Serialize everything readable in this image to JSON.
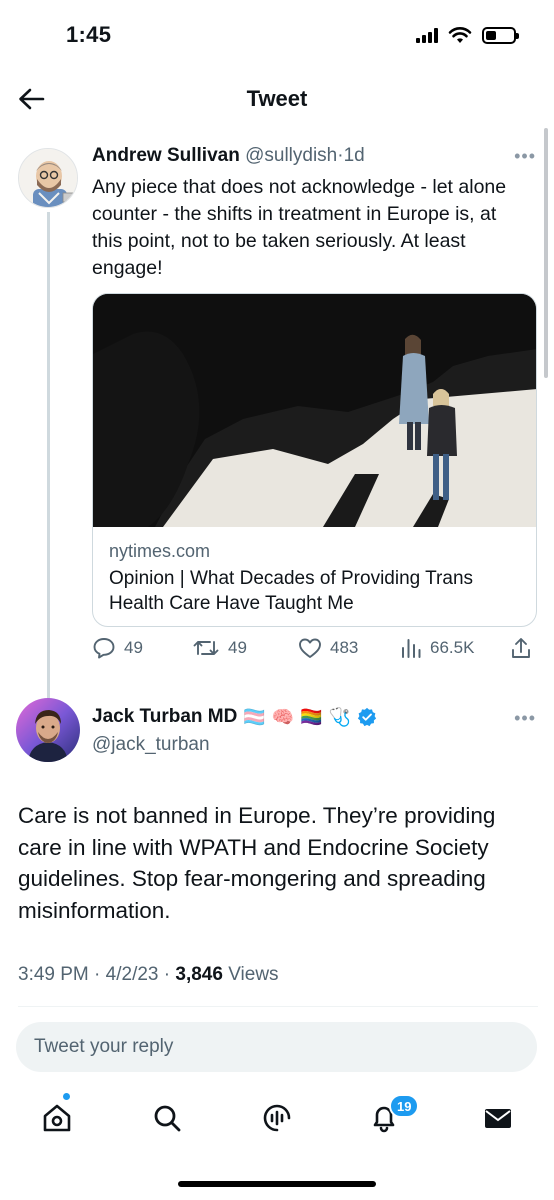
{
  "status_bar": {
    "time": "1:45",
    "icons": [
      "signal-icon",
      "wifi-icon",
      "battery-icon"
    ],
    "battery_level": 0.4
  },
  "header": {
    "title": "Tweet",
    "back_icon": "arrow-left-icon"
  },
  "parent_tweet": {
    "author_name": "Andrew Sullivan",
    "handle": "@sullydish",
    "separator": "·",
    "time": "1d",
    "text": "Any piece that does not acknowledge - let alone counter - the shifts in treatment in Europe is, at this point, not to be taken seriously. At least engage!",
    "link_card": {
      "domain": "nytimes.com",
      "title": "Opinion | What Decades of Providing Trans Health Care Have Taught Me"
    },
    "actions": {
      "replies": "49",
      "retweets": "49",
      "likes": "483",
      "views": "66.5K"
    }
  },
  "focal_tweet": {
    "author_name": "Jack Turban MD",
    "name_emojis": [
      "🏳️‍⚧️",
      "🧠",
      "🏳️‍🌈",
      "🩺"
    ],
    "handle": "@jack_turban",
    "text": "Care is not banned in Europe. They’re providing care in line with WPATH and Endocrine Society guidelines. Stop fear-mongering and spreading misinformation.",
    "time": "3:49 PM",
    "date": "4/2/23",
    "separator": "·",
    "views_count": "3,846",
    "views_label": "Views"
  },
  "reply_bar": {
    "placeholder": "Tweet your reply"
  },
  "tab_bar": {
    "notification_count": "19",
    "tabs": [
      "home-icon",
      "search-icon",
      "spaces-icon",
      "notifications-icon",
      "messages-icon"
    ]
  },
  "colors": {
    "accent": "#1d9bf0",
    "text": "#0f1419",
    "secondary": "#536471",
    "border": "#cfd9de"
  }
}
